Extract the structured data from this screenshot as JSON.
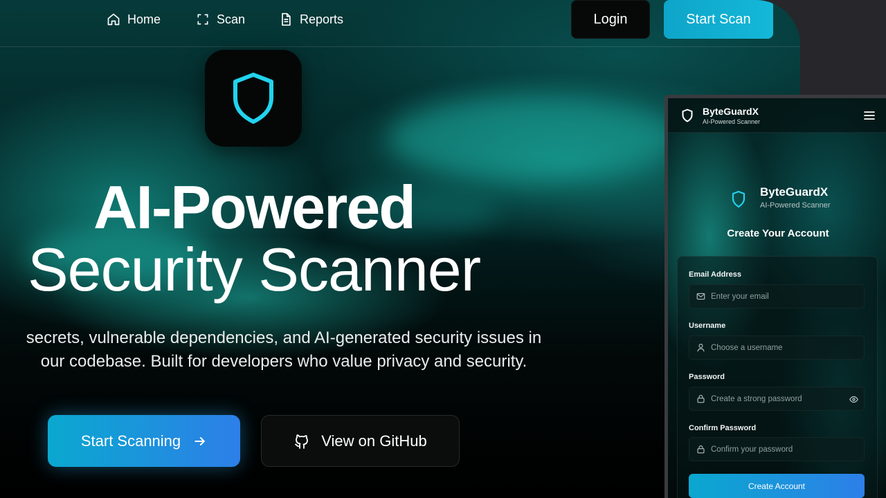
{
  "nav": {
    "links": [
      {
        "label": "Home",
        "icon": "home-icon"
      },
      {
        "label": "Scan",
        "icon": "scan-icon"
      },
      {
        "label": "Reports",
        "icon": "document-icon"
      }
    ],
    "login_label": "Login",
    "start_scan_label": "Start Scan"
  },
  "hero": {
    "logo_icon": "shield-icon",
    "title_line1": "AI-Powered",
    "title_line2": "Security Scanner",
    "description_line1": "secrets, vulnerable dependencies, and AI-generated security issues in",
    "description_line2": "our codebase. Built for developers who value privacy and security.",
    "primary_cta": "Start Scanning",
    "secondary_cta": "View on GitHub"
  },
  "mobile": {
    "brand_name": "ByteGuardX",
    "brand_tagline": "AI-Powered Scanner",
    "form_title": "Create Your Account",
    "fields": [
      {
        "label": "Email Address",
        "placeholder": "Enter your email",
        "icon": "mail-icon"
      },
      {
        "label": "Username",
        "placeholder": "Choose a username",
        "icon": "user-icon"
      },
      {
        "label": "Password",
        "placeholder": "Create a strong password",
        "icon": "lock-icon"
      },
      {
        "label": "Confirm Password",
        "placeholder": "Confirm your password",
        "icon": "lock-icon"
      }
    ],
    "submit_label": "Create Account"
  },
  "colors": {
    "accent": "#14b8d8",
    "gradient_start": "#0aa8cf",
    "gradient_end": "#2d7fe8",
    "shield": "#22d3ee",
    "teal_bg": "#063a3a"
  }
}
